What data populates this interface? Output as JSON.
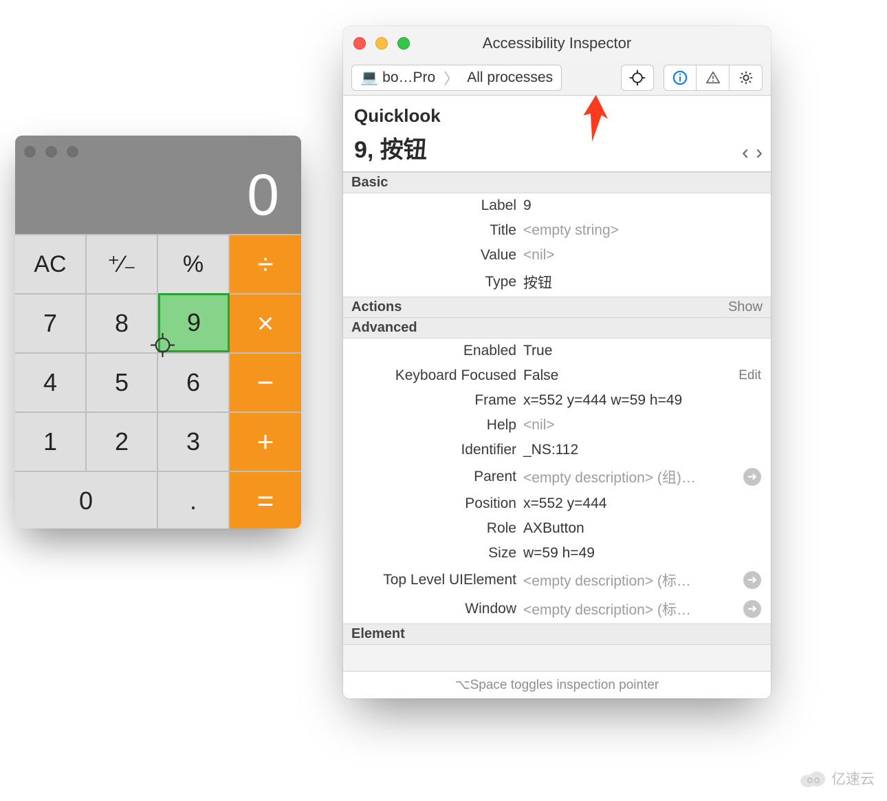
{
  "calculator": {
    "display": "0",
    "buttons": {
      "ac": "AC",
      "sign": "⁺∕₋",
      "pct": "%",
      "div": "÷",
      "7": "7",
      "8": "8",
      "9": "9",
      "mul": "×",
      "4": "4",
      "5": "5",
      "6": "6",
      "sub": "−",
      "1": "1",
      "2": "2",
      "3": "3",
      "add": "+",
      "0": "0",
      "dot": ".",
      "eq": "="
    },
    "highlighted": "9"
  },
  "inspector": {
    "window_title": "Accessibility Inspector",
    "breadcrumb": {
      "device": "bo…Pro",
      "scope": "All processes"
    },
    "quicklook": {
      "section": "Quicklook",
      "label": "9, 按钮"
    },
    "nav": {
      "prev": "‹",
      "next": "›"
    },
    "sections": {
      "basic": "Basic",
      "actions": "Actions",
      "show": "Show",
      "advanced": "Advanced",
      "element": "Element"
    },
    "basic": {
      "Label": "9",
      "Title": "<empty string>",
      "Value": "<nil>",
      "Type": "按钮"
    },
    "advanced": {
      "Enabled": "True",
      "Keyboard Focused": "False",
      "Frame": "x=552 y=444 w=59 h=49",
      "Help": "<nil>",
      "Identifier": "_NS:112",
      "Parent": "<empty description> (组)…",
      "Position": "x=552 y=444",
      "Role": "AXButton",
      "Size": "w=59 h=49",
      "Top Level UIElement": "<empty description> (标…",
      "Window": "<empty description> (标…"
    },
    "edit_label": "Edit",
    "footer": "⌥Space toggles inspection pointer"
  },
  "watermark": "亿速云"
}
